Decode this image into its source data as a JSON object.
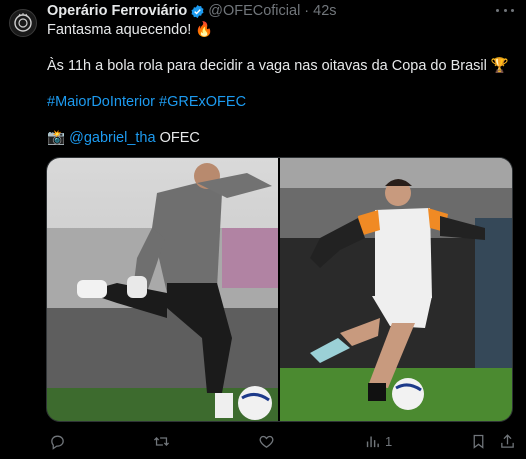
{
  "post": {
    "author_name": "Operário Ferroviário",
    "handle": "@OFECoficial",
    "separator": "·",
    "time": "42s",
    "line1": "Fantasma aquecendo! 🔥",
    "line2": "Às 11h a bola rola para decidir a vaga nas oitavas da Copa do Brasil 🏆",
    "hashtag1": "#MaiorDoInterior",
    "hashtag2": "#GRExOFEC",
    "camera_emoji": "📸",
    "mention": "@gabriel_tha",
    "credit_suffix": "OFEC"
  },
  "actions": {
    "views_count": "1"
  },
  "colors": {
    "background": "#000000",
    "text": "#e7e9ea",
    "muted": "#71767b",
    "link": "#1d9bf0",
    "verified": "#1d9bf0"
  },
  "icons": [
    "avatar-crest-icon",
    "verified-badge-icon",
    "more-icon",
    "reply-icon",
    "retweet-icon",
    "like-icon",
    "views-icon",
    "bookmark-icon",
    "share-icon"
  ]
}
